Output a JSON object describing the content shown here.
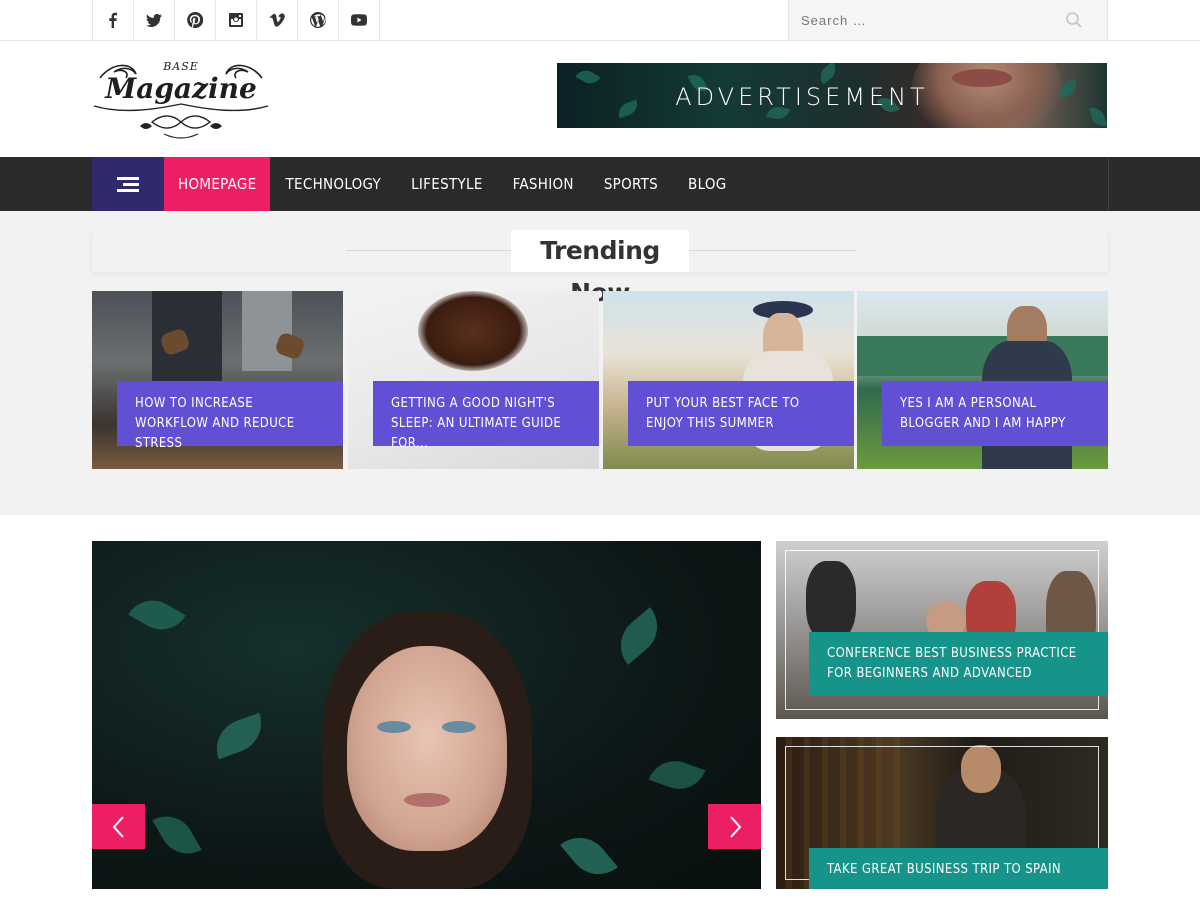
{
  "topbar": {
    "social_icons": [
      "facebook-icon",
      "twitter-icon",
      "pinterest-icon",
      "instagram-icon",
      "vimeo-icon",
      "wordpress-icon",
      "youtube-icon"
    ],
    "search_placeholder": "Search …"
  },
  "header": {
    "logo_small": "BASE",
    "logo_main": "Magazine",
    "ad_text": "ADVERTISEMENT"
  },
  "nav": {
    "items": [
      "HOMEPAGE",
      "TECHNOLOGY",
      "LIFESTYLE",
      "FASHION",
      "SPORTS",
      "BLOG"
    ],
    "active": "HOMEPAGE"
  },
  "trending": {
    "heading": "Trending Now",
    "cards": [
      {
        "title": "HOW TO INCREASE WORKFLOW AND REDUCE STRESS"
      },
      {
        "title": "GETTING A GOOD NIGHT'S SLEEP: AN ULTIMATE GUIDE FOR..."
      },
      {
        "title": "PUT YOUR BEST FACE TO ENJOY THIS SUMMER"
      },
      {
        "title": "YES I AM A PERSONAL BLOGGER AND I AM HAPPY"
      }
    ]
  },
  "featured": {
    "side_posts": [
      {
        "title": "CONFERENCE BEST BUSINESS PRACTICE FOR BEGINNERS AND ADVANCED"
      },
      {
        "title": "TAKE GREAT BUSINESS TRIP TO SPAIN"
      }
    ]
  },
  "colors": {
    "accent_pink": "#ec1f64",
    "menu_purple": "#2e2a6b",
    "caption_purple": "#6150d4",
    "caption_teal": "#179489",
    "nav_dark": "#2a2a2a"
  }
}
